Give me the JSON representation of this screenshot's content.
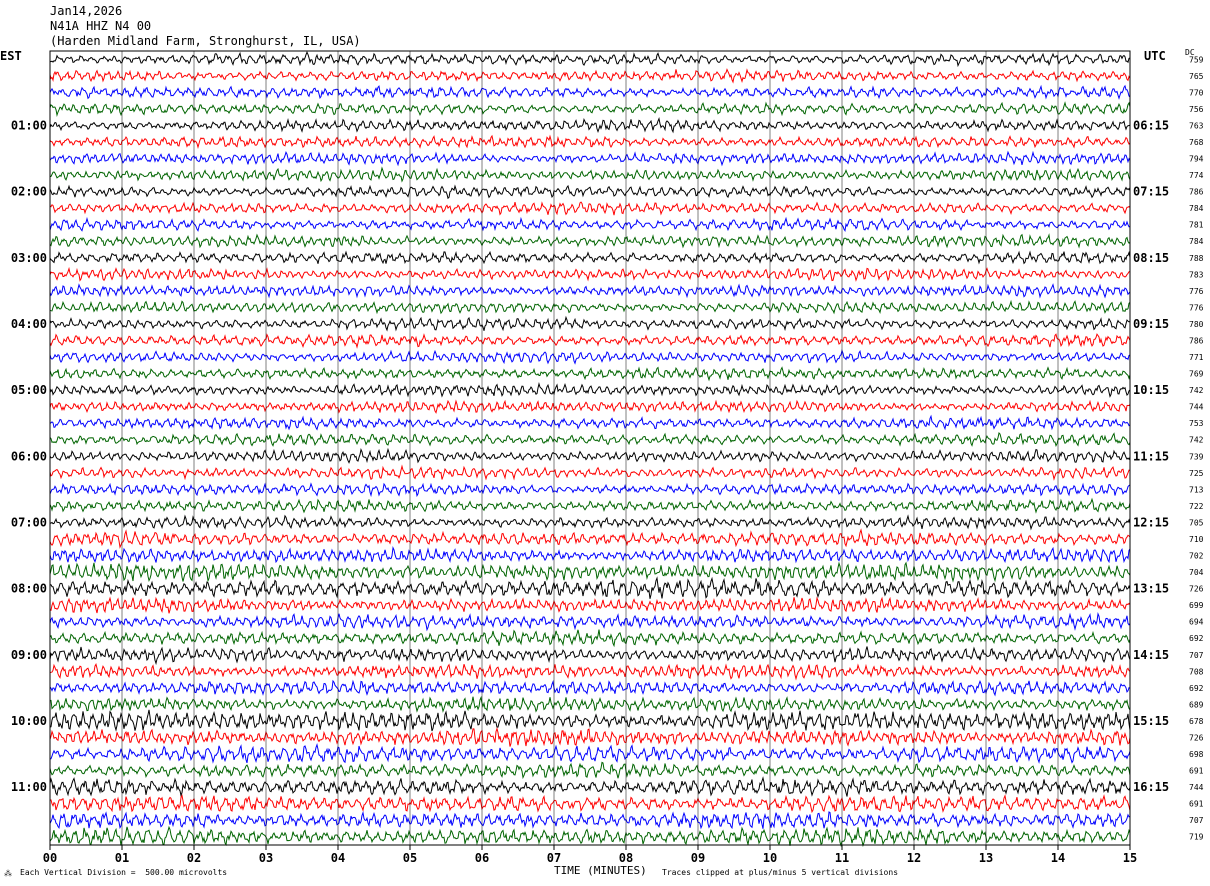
{
  "header": {
    "date": "Jan14,2026",
    "station": "N41A HHZ N4 00",
    "location": "(Harden Midland Farm, Stronghurst, IL, USA)"
  },
  "left_timezone": "EST",
  "right_timezone": "UTC",
  "dc_label": "DC",
  "footer": {
    "scale_note": "Each Vertical Division =  500.00 microvolts",
    "clip_note": "Traces clipped at plus/minus 5 vertical divisions",
    "logo_mark": "⁂"
  },
  "colors": {
    "trace_cycle": [
      "#000000",
      "#ff0000",
      "#0000ff",
      "#006400"
    ],
    "grid": "#000000",
    "background": "#ffffff"
  },
  "chart_data": {
    "type": "line",
    "subtype": "helicorder",
    "xlabel": "TIME (MINUTES)",
    "xlim": [
      0,
      15
    ],
    "x_ticks": [
      "00",
      "01",
      "02",
      "03",
      "04",
      "05",
      "06",
      "07",
      "08",
      "09",
      "10",
      "11",
      "12",
      "13",
      "14",
      "15"
    ],
    "row_count": 48,
    "minutes_per_row": 15,
    "left_hour_labels": [
      "01:00",
      "02:00",
      "03:00",
      "04:00",
      "05:00",
      "06:00",
      "07:00",
      "08:00",
      "09:00",
      "10:00",
      "11:00"
    ],
    "right_hour_labels": [
      "06:15",
      "07:15",
      "08:15",
      "09:15",
      "10:15",
      "11:15",
      "12:15",
      "13:15",
      "14:15",
      "15:15",
      "16:15"
    ],
    "dc_offsets": [
      759,
      765,
      770,
      756,
      763,
      768,
      794,
      774,
      786,
      784,
      781,
      784,
      788,
      783,
      776,
      776,
      780,
      786,
      771,
      769,
      742,
      744,
      753,
      742,
      739,
      725,
      713,
      722,
      705,
      710,
      702,
      704,
      726,
      699,
      694,
      692,
      707,
      708,
      692,
      689,
      678,
      726,
      698,
      691,
      744,
      691,
      707,
      719
    ],
    "row_amplitude": [
      4,
      4,
      4,
      4,
      4,
      4,
      4,
      4,
      4,
      4,
      4,
      4,
      4,
      4,
      4,
      4,
      4,
      4,
      4,
      4,
      4,
      4,
      4,
      4,
      4,
      4,
      4,
      4,
      4,
      5,
      5,
      6,
      7,
      5,
      5,
      5,
      5,
      5,
      5,
      5,
      7,
      6,
      6,
      5,
      6,
      6,
      6,
      6
    ]
  }
}
